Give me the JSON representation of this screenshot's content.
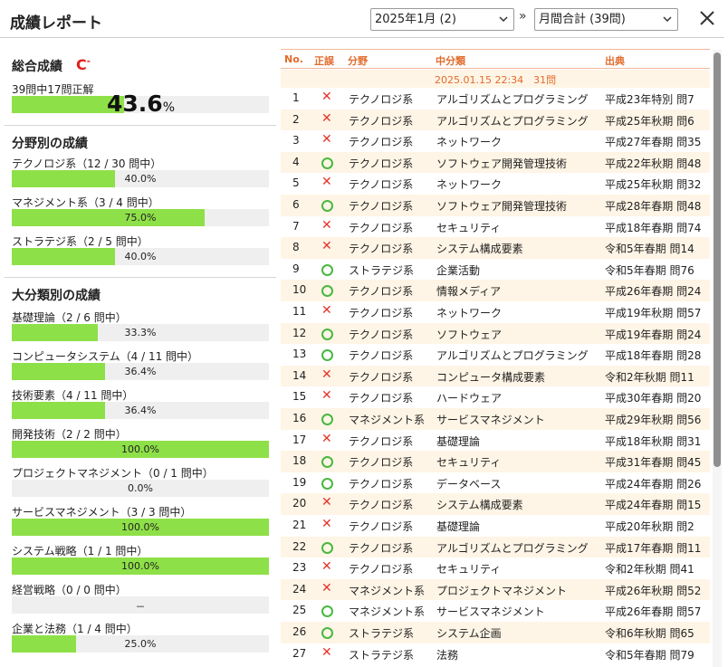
{
  "header": {
    "title": "成績レポート",
    "month_select": "2025年1月 (2)",
    "separator": "»",
    "sum_select": "月間合計 (39問)"
  },
  "overall": {
    "heading": "総合成績",
    "grade": "C",
    "grade_sup": "-",
    "summary": "39問中17問正解",
    "percent": "43.6",
    "percent_unit": "%",
    "ratio": 0.436
  },
  "field_section": {
    "heading": "分野別の成績",
    "items": [
      {
        "label": "テクノロジ系（12 / 30 問中）",
        "pct": "40.0%",
        "ratio": 0.4
      },
      {
        "label": "マネジメント系（3 / 4 問中）",
        "pct": "75.0%",
        "ratio": 0.75
      },
      {
        "label": "ストラテジ系（2 / 5 問中）",
        "pct": "40.0%",
        "ratio": 0.4
      }
    ]
  },
  "category_section": {
    "heading": "大分類別の成績",
    "items": [
      {
        "label": "基礎理論（2 / 6 問中）",
        "pct": "33.3%",
        "ratio": 0.333
      },
      {
        "label": "コンピュータシステム（4 / 11 問中）",
        "pct": "36.4%",
        "ratio": 0.364
      },
      {
        "label": "技術要素（4 / 11 問中）",
        "pct": "36.4%",
        "ratio": 0.364
      },
      {
        "label": "開発技術（2 / 2 問中）",
        "pct": "100.0%",
        "ratio": 1.0
      },
      {
        "label": "プロジェクトマネジメント（0 / 1 問中）",
        "pct": "0.0%",
        "ratio": 0.0
      },
      {
        "label": "サービスマネジメント（3 / 3 問中）",
        "pct": "100.0%",
        "ratio": 1.0
      },
      {
        "label": "システム戦略（1 / 1 問中）",
        "pct": "100.0%",
        "ratio": 1.0
      },
      {
        "label": "経営戦略（0 / 0 問中）",
        "pct": "－",
        "ratio": 0.0
      },
      {
        "label": "企業と法務（1 / 4 問中）",
        "pct": "25.0%",
        "ratio": 0.25
      }
    ]
  },
  "table": {
    "headers": {
      "no": "No.",
      "result": "正誤",
      "field": "分野",
      "category": "中分類",
      "source": "出典"
    },
    "session": "2025.01.15 22:34　31問",
    "colors": {
      "wrong": "#e4332a",
      "correct": "#48b840",
      "accent": "#e26b2b"
    },
    "rows": [
      {
        "no": "1",
        "ok": false,
        "field": "テクノロジ系",
        "category": "アルゴリズムとプログラミング",
        "source": "平成23年特別 問7"
      },
      {
        "no": "2",
        "ok": false,
        "field": "テクノロジ系",
        "category": "アルゴリズムとプログラミング",
        "source": "平成25年秋期 問6"
      },
      {
        "no": "3",
        "ok": false,
        "field": "テクノロジ系",
        "category": "ネットワーク",
        "source": "平成27年春期 問35"
      },
      {
        "no": "4",
        "ok": true,
        "field": "テクノロジ系",
        "category": "ソフトウェア開発管理技術",
        "source": "平成22年秋期 問48"
      },
      {
        "no": "5",
        "ok": false,
        "field": "テクノロジ系",
        "category": "ネットワーク",
        "source": "平成25年秋期 問32"
      },
      {
        "no": "6",
        "ok": true,
        "field": "テクノロジ系",
        "category": "ソフトウェア開発管理技術",
        "source": "平成28年春期 問48"
      },
      {
        "no": "7",
        "ok": false,
        "field": "テクノロジ系",
        "category": "セキュリティ",
        "source": "平成18年春期 問74"
      },
      {
        "no": "8",
        "ok": false,
        "field": "テクノロジ系",
        "category": "システム構成要素",
        "source": "令和5年春期 問14"
      },
      {
        "no": "9",
        "ok": true,
        "field": "ストラテジ系",
        "category": "企業活動",
        "source": "令和5年春期 問76"
      },
      {
        "no": "10",
        "ok": true,
        "field": "テクノロジ系",
        "category": "情報メディア",
        "source": "平成26年春期 問24"
      },
      {
        "no": "11",
        "ok": false,
        "field": "テクノロジ系",
        "category": "ネットワーク",
        "source": "平成19年秋期 問57"
      },
      {
        "no": "12",
        "ok": true,
        "field": "テクノロジ系",
        "category": "ソフトウェア",
        "source": "平成19年春期 問24"
      },
      {
        "no": "13",
        "ok": true,
        "field": "テクノロジ系",
        "category": "アルゴリズムとプログラミング",
        "source": "平成18年春期 問28"
      },
      {
        "no": "14",
        "ok": false,
        "field": "テクノロジ系",
        "category": "コンピュータ構成要素",
        "source": "令和2年秋期 問11"
      },
      {
        "no": "15",
        "ok": false,
        "field": "テクノロジ系",
        "category": "ハードウェア",
        "source": "平成30年春期 問20"
      },
      {
        "no": "16",
        "ok": true,
        "field": "マネジメント系",
        "category": "サービスマネジメント",
        "source": "平成29年秋期 問56"
      },
      {
        "no": "17",
        "ok": false,
        "field": "テクノロジ系",
        "category": "基礎理論",
        "source": "平成18年秋期 問31"
      },
      {
        "no": "18",
        "ok": true,
        "field": "テクノロジ系",
        "category": "セキュリティ",
        "source": "平成31年春期 問45"
      },
      {
        "no": "19",
        "ok": true,
        "field": "テクノロジ系",
        "category": "データベース",
        "source": "平成24年春期 問26"
      },
      {
        "no": "20",
        "ok": false,
        "field": "テクノロジ系",
        "category": "システム構成要素",
        "source": "平成24年春期 問15"
      },
      {
        "no": "21",
        "ok": false,
        "field": "テクノロジ系",
        "category": "基礎理論",
        "source": "平成20年秋期 問2"
      },
      {
        "no": "22",
        "ok": true,
        "field": "テクノロジ系",
        "category": "アルゴリズムとプログラミング",
        "source": "平成17年春期 問11"
      },
      {
        "no": "23",
        "ok": false,
        "field": "テクノロジ系",
        "category": "セキュリティ",
        "source": "令和2年秋期 問41"
      },
      {
        "no": "24",
        "ok": false,
        "field": "マネジメント系",
        "category": "プロジェクトマネジメント",
        "source": "平成26年秋期 問52"
      },
      {
        "no": "25",
        "ok": true,
        "field": "マネジメント系",
        "category": "サービスマネジメント",
        "source": "平成26年春期 問57"
      },
      {
        "no": "26",
        "ok": true,
        "field": "ストラテジ系",
        "category": "システム企画",
        "source": "令和6年秋期 問65"
      },
      {
        "no": "27",
        "ok": false,
        "field": "ストラテジ系",
        "category": "法務",
        "source": "令和5年春期 問79"
      }
    ]
  }
}
